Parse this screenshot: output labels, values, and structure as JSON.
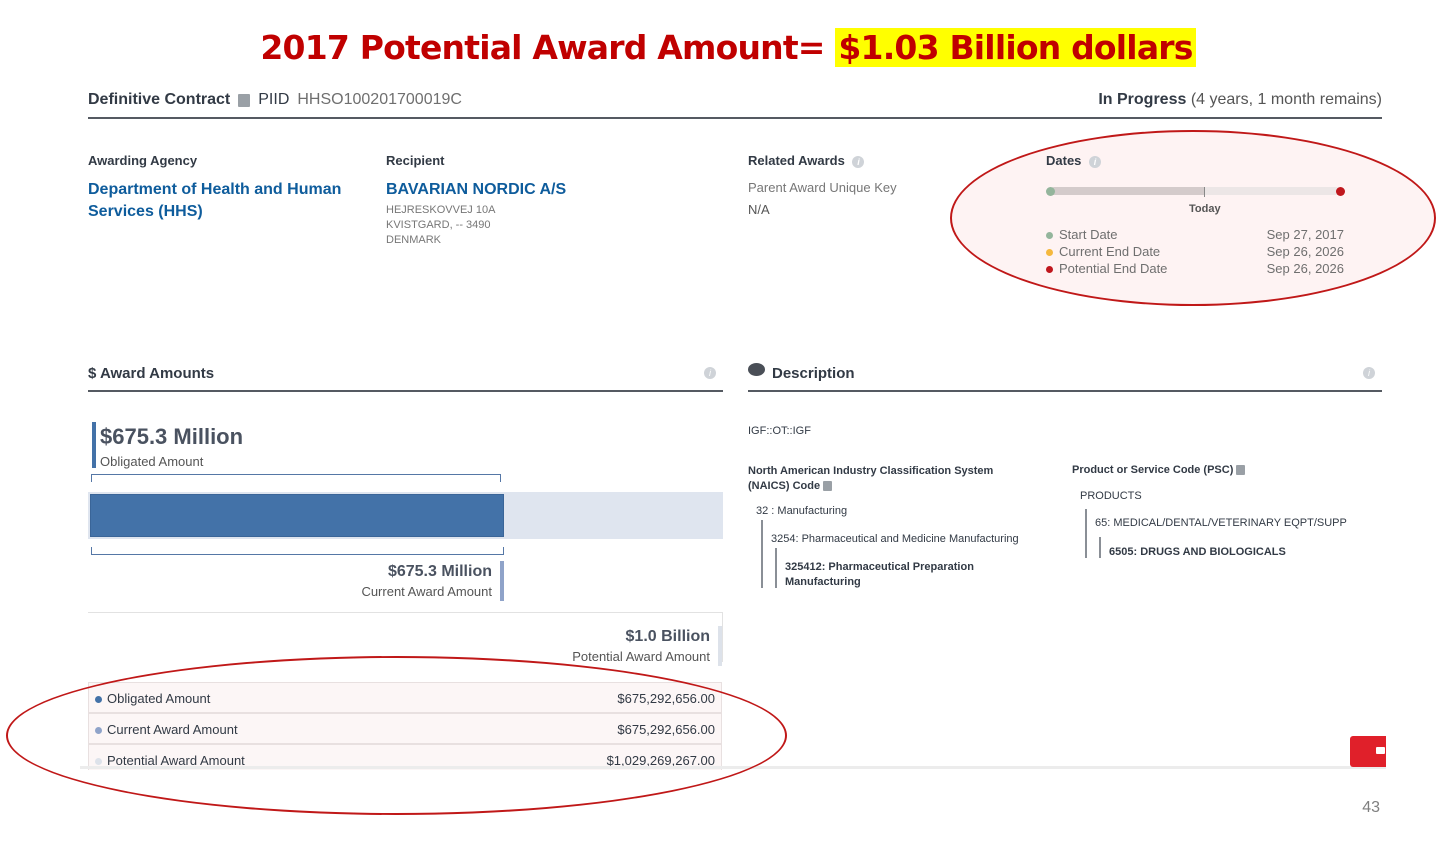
{
  "slide": {
    "title_prefix": "2017 Potential Award Amount=",
    "title_highlight": "$1.03 Billion dollars",
    "page_number": "43"
  },
  "header": {
    "contract_type": "Definitive Contract",
    "piid_label": "PIID",
    "piid_value": "HHSO100201700019C",
    "status": "In Progress",
    "status_detail": "(4 years, 1 month remains)"
  },
  "agency": {
    "label": "Awarding Agency",
    "name_line1": "Department of Health and Human",
    "name_line2": "Services (HHS)"
  },
  "recipient": {
    "label": "Recipient",
    "name": "BAVARIAN NORDIC A/S",
    "address1": "HEJRESKOVVEJ 10A",
    "address2": "KVISTGARD, -- 3490",
    "address3": "DENMARK"
  },
  "related": {
    "label": "Related Awards",
    "key_label": "Parent Award Unique Key",
    "key_value": "N/A"
  },
  "dates": {
    "label": "Dates",
    "today_label": "Today",
    "elapsed_fraction": 0.53,
    "rows": [
      {
        "label": "Start Date",
        "value": "Sep 27, 2017",
        "color": "#94b59c"
      },
      {
        "label": "Current End Date",
        "value": "Sep 26, 2026",
        "color": "#f5b83d"
      },
      {
        "label": "Potential End Date",
        "value": "Sep 26, 2026",
        "color": "#c0171d"
      }
    ]
  },
  "award": {
    "section_title": "$ Award Amounts",
    "obligated_big": "$675.3 Million",
    "obligated_label": "Obligated Amount",
    "current_big": "$675.3 Million",
    "current_label": "Current Award Amount",
    "potential_big": "$1.0 Billion",
    "potential_label": "Potential Award Amount",
    "obligated_fraction": 0.656,
    "table": [
      {
        "label": "Obligated Amount",
        "value": "$675,292,656.00",
        "color": "#4372a8"
      },
      {
        "label": "Current Award Amount",
        "value": "$675,292,656.00",
        "color": "#8fa3c9"
      },
      {
        "label": "Potential Award Amount",
        "value": "$1,029,269,267.00",
        "color": "#dde2ea"
      }
    ]
  },
  "description": {
    "section_title": "Description",
    "text": "IGF::OT::IGF",
    "naics_label_line1": "North American Industry Classification System",
    "naics_label_line2": "(NAICS)  Code",
    "naics_l1": "32 : Manufacturing",
    "naics_l2": "3254: Pharmaceutical and Medicine Manufacturing",
    "naics_l3_line1": "325412: Pharmaceutical Preparation",
    "naics_l3_line2": "Manufacturing",
    "psc_label": "Product or Service Code  (PSC)",
    "psc_l1": "PRODUCTS",
    "psc_l2": "65: MEDICAL/DENTAL/VETERINARY EQPT/SUPP",
    "psc_l3": "6505: DRUGS AND BIOLOGICALS"
  }
}
